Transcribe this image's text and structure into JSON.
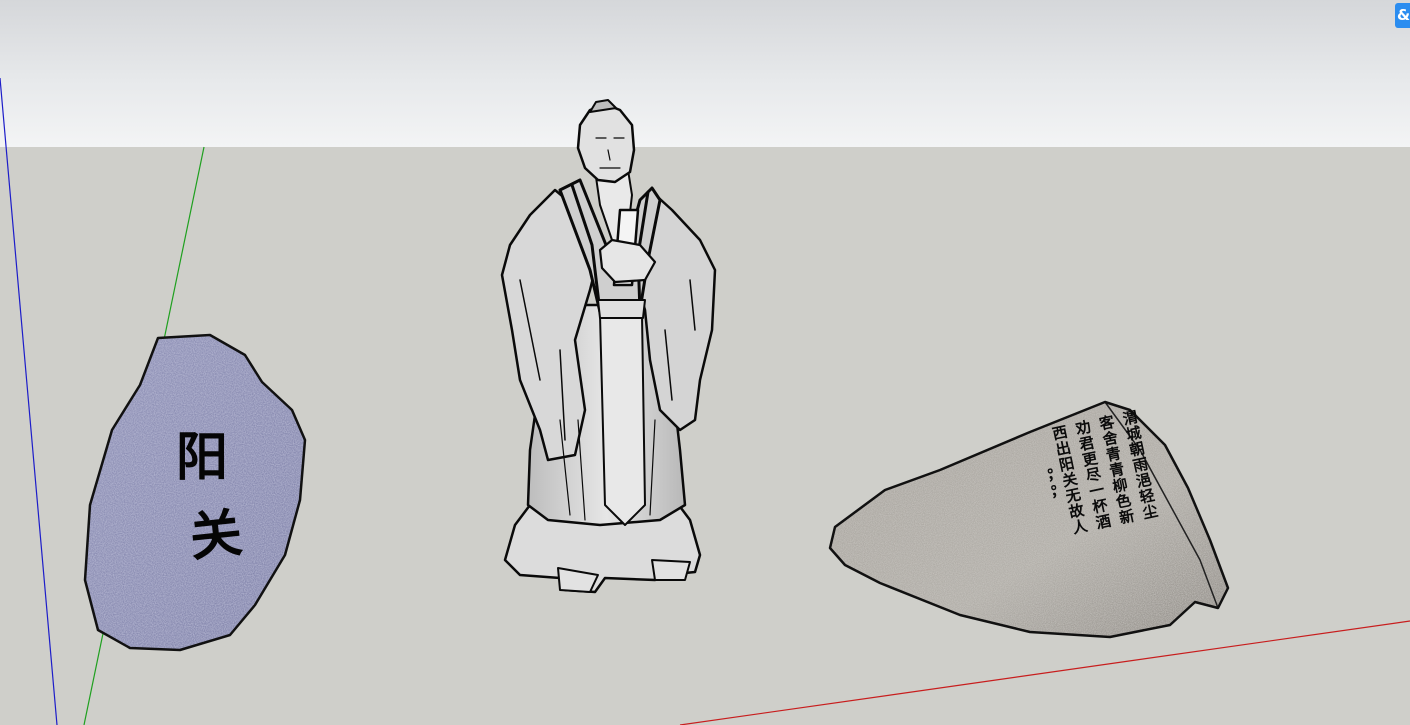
{
  "app": {
    "name": "3D modeling viewport"
  },
  "toolbar": {
    "corner_button_icon": "link-icon",
    "corner_button_glyph": "&"
  },
  "scene": {
    "axes_colors": {
      "blue": "#1d1dc9",
      "green": "#1fa01f",
      "red": "#c81d1d"
    },
    "colors": {
      "sky_top": "#d5d7da",
      "ground": "#cfcfca",
      "rock_left": "#8f91b4",
      "rock_right": "#a9a6a1",
      "statue": "#d9d9d9"
    },
    "rock_left": {
      "char_1": "阳",
      "char_2": "关"
    },
    "rock_right": {
      "poem_columns": [
        "渭城朝雨浥轻尘",
        "客舍青青柳色新",
        "劝君更尽一杯酒",
        "西出阳关无故人",
        "。，。，"
      ]
    }
  }
}
